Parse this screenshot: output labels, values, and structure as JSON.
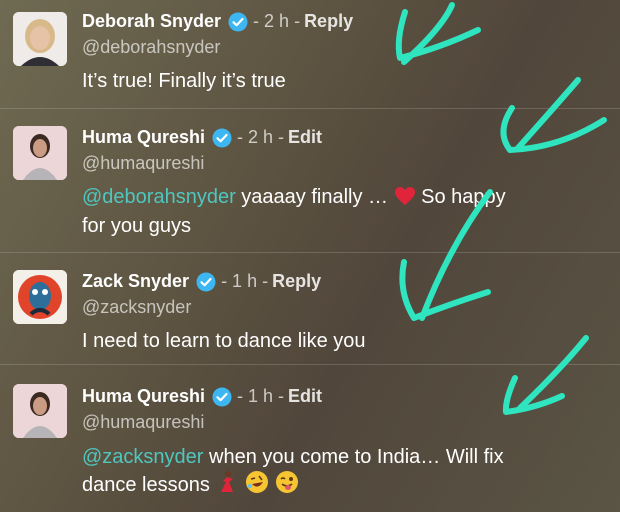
{
  "comments": [
    {
      "name": "Deborah Snyder",
      "time": "- 2 h -",
      "action": "Reply",
      "handle": "@deborahsnyder",
      "text": "It’s true!  Finally it’s true"
    },
    {
      "name": "Huma Qureshi",
      "time": "- 2 h -",
      "action": "Edit",
      "handle": "@humaqureshi",
      "mention": "@deborahsnyder",
      "text_a": " yaaaay finally … ",
      "text_b": " So happy",
      "text_c": "for you guys"
    },
    {
      "name": "Zack Snyder",
      "time": "- 1 h -",
      "action": "Reply",
      "handle": "@zacksnyder",
      "text": "I need to learn to dance like you"
    },
    {
      "name": "Huma Qureshi",
      "time": "- 1 h -",
      "action": "Edit",
      "handle": "@humaqureshi",
      "mention": "@zacksnyder",
      "text_a": " when you come to India… Will fix",
      "text_b": "dance lessons "
    }
  ],
  "icons": {
    "verified": "verified-badge-icon",
    "heart": "red-heart-emoji",
    "dancer": "dancer-emoji",
    "laugh": "rolling-laughing-emoji",
    "wink": "winking-tongue-emoji"
  },
  "colors": {
    "mention": "#4fc7c0",
    "annotation": "#2fe5c0",
    "verified": "#3db7f2"
  }
}
